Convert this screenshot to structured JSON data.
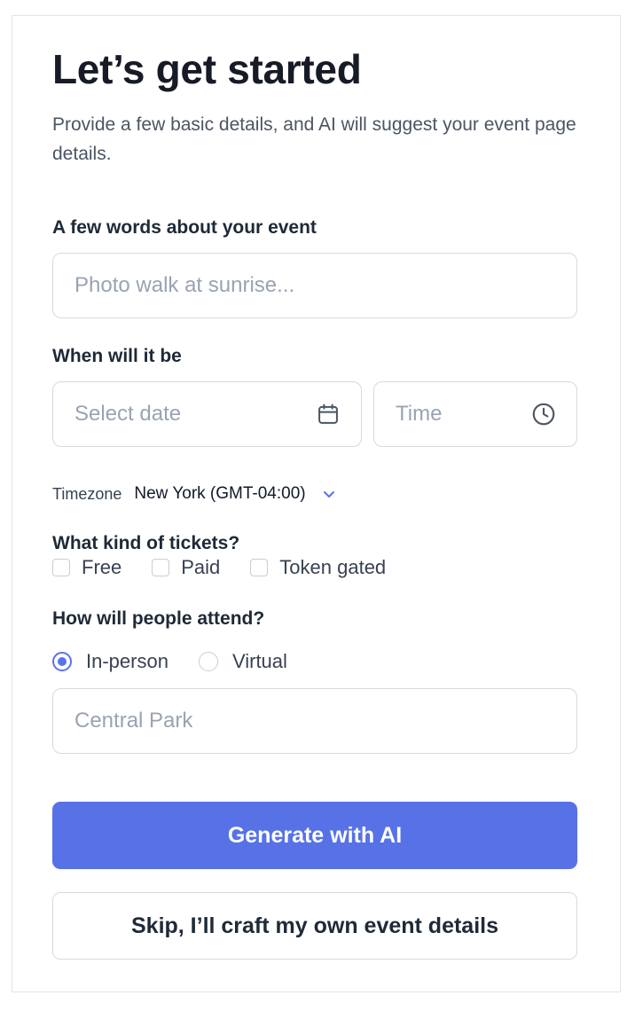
{
  "header": {
    "title": "Let’s get started",
    "subtitle": "Provide a few basic details, and AI will suggest your event page details."
  },
  "about": {
    "label": "A few words about your event",
    "placeholder": "Photo walk at sunrise...",
    "value": ""
  },
  "when": {
    "label": "When will it be",
    "date_placeholder": "Select date",
    "time_placeholder": "Time",
    "date_icon": "calendar-icon",
    "time_icon": "clock-icon"
  },
  "timezone": {
    "label": "Timezone",
    "value": "New York (GMT-04:00)",
    "icon": "chevron-down-icon"
  },
  "tickets": {
    "label": "What kind of tickets?",
    "options": [
      {
        "label": "Free",
        "checked": false
      },
      {
        "label": "Paid",
        "checked": false
      },
      {
        "label": "Token gated",
        "checked": false
      }
    ]
  },
  "attendance": {
    "label": "How will people attend?",
    "options": [
      {
        "label": "In-person",
        "selected": true
      },
      {
        "label": "Virtual",
        "selected": false
      }
    ],
    "location_placeholder": "Central Park"
  },
  "actions": {
    "generate_label": "Generate with AI",
    "skip_label": "Skip, I’ll craft my own event details"
  },
  "colors": {
    "accent": "#5672e6",
    "title": "#161b26",
    "muted": "#4b5563",
    "border": "#d6d9df"
  }
}
